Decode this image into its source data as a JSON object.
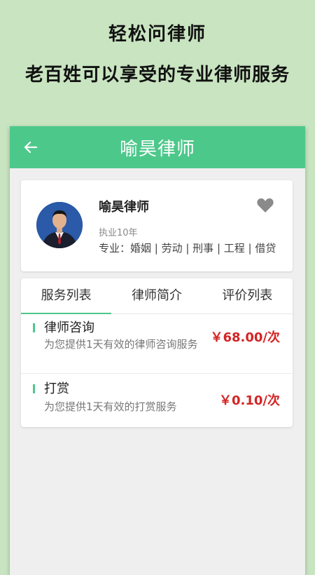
{
  "promo": {
    "line1": "轻松问律师",
    "line2": "老百姓可以享受的专业律师服务"
  },
  "topbar": {
    "back_icon": "arrow-left-icon",
    "title": "喻昊律师"
  },
  "profile": {
    "avatar_icon": "lawyer-avatar",
    "name": "喻昊律师",
    "years": "执业10年",
    "specialty": "专业：婚姻 | 劳动 | 刑事 | 工程 | 借贷",
    "favorite_icon": "heart-icon"
  },
  "tabs": [
    {
      "label": "服务列表",
      "active": true
    },
    {
      "label": "律师简介",
      "active": false
    },
    {
      "label": "评价列表",
      "active": false
    }
  ],
  "services": [
    {
      "title": "律师咨询",
      "desc": "为您提供1天有效的律师咨询服务",
      "price": "￥68.00/次"
    },
    {
      "title": "打赏",
      "desc": "为您提供1天有效的打赏服务",
      "price": "￥0.10/次"
    }
  ],
  "colors": {
    "accent": "#4dc88b",
    "price": "#d42424",
    "background": "#c8e4c0"
  }
}
